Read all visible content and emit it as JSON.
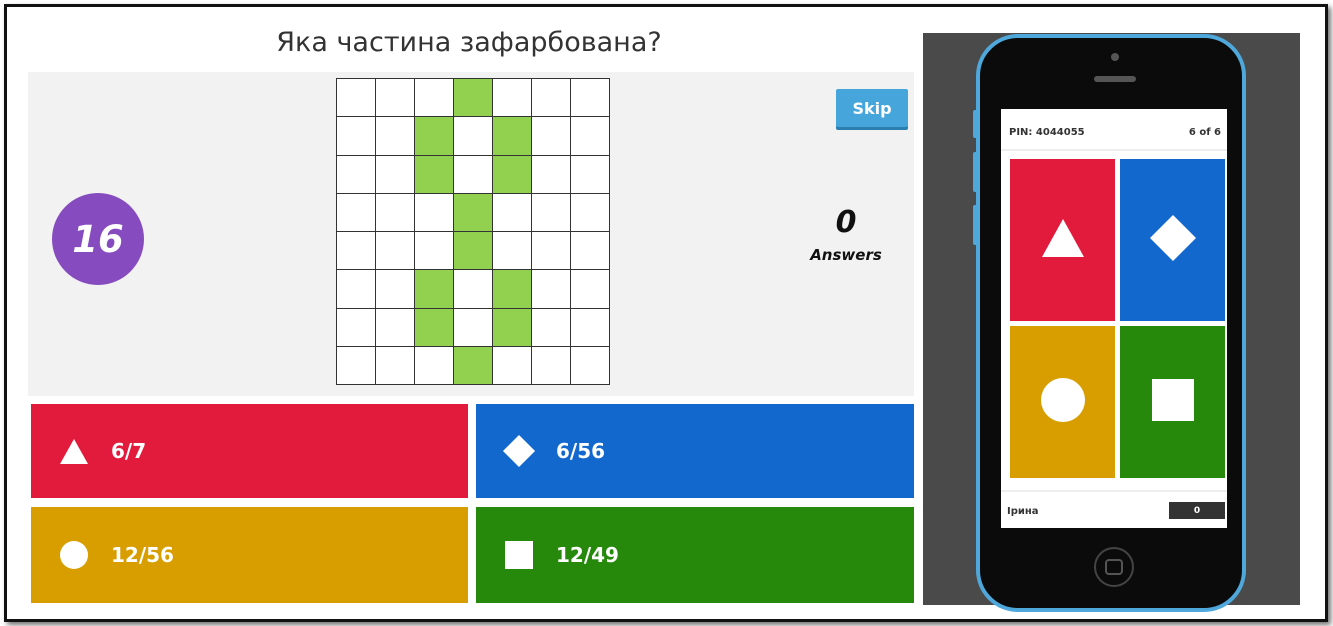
{
  "question": "Яка частина зафарбована?",
  "timer": "16",
  "skip_label": "Skip",
  "answers_count": "0",
  "answers_label": "Answers",
  "grid": {
    "rows": 8,
    "cols": 7,
    "filled": [
      [
        0,
        3
      ],
      [
        1,
        2
      ],
      [
        1,
        4
      ],
      [
        2,
        2
      ],
      [
        2,
        4
      ],
      [
        3,
        3
      ],
      [
        4,
        3
      ],
      [
        5,
        2
      ],
      [
        5,
        4
      ],
      [
        6,
        2
      ],
      [
        6,
        4
      ],
      [
        7,
        3
      ]
    ],
    "fill_color": "#92d050"
  },
  "answers": [
    {
      "shape": "triangle-icon",
      "text": "6/7",
      "color": "#e21b3c"
    },
    {
      "shape": "diamond-icon",
      "text": "6/56",
      "color": "#1368ce"
    },
    {
      "shape": "circle-icon",
      "text": "12/56",
      "color": "#d89e00"
    },
    {
      "shape": "square-icon",
      "text": "12/49",
      "color": "#26890c"
    }
  ],
  "phone": {
    "pin": "PIN: 4044055",
    "progress": "6 of 6",
    "player_name": "Ірина",
    "score": "0"
  }
}
